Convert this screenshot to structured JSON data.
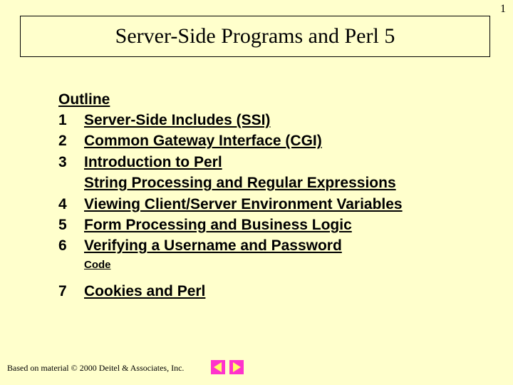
{
  "page_number": "1",
  "title": "Server-Side Programs and Perl 5",
  "outline": {
    "heading": "Outline",
    "items": [
      {
        "num": "1",
        "label": "Server-Side Includes (SSI)"
      },
      {
        "num": "2",
        "label": "Common Gateway Interface (CGI)"
      },
      {
        "num": "3",
        "label": "Introduction to Perl"
      },
      {
        "num": "",
        "label": "String Processing and Regular Expressions"
      },
      {
        "num": "4",
        "label": "Viewing Client/Server Environment Variables"
      },
      {
        "num": "5",
        "label": "Form Processing and Business Logic"
      },
      {
        "num": "6",
        "label": "Verifying a Username and Password"
      }
    ],
    "sub_after_6": "Code",
    "items2": [
      {
        "num": "7",
        "label": "Cookies and Perl"
      }
    ]
  },
  "footer": "Based on material © 2000 Deitel & Associates, Inc."
}
